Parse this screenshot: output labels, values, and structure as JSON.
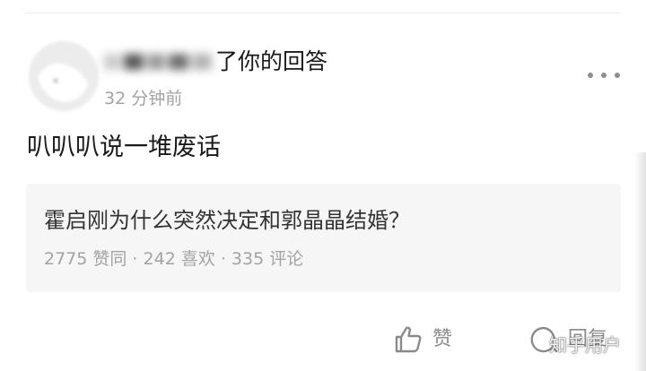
{
  "notification": {
    "actor_name": "",
    "action_text": "了你的回答",
    "time": "32 分钟前",
    "more_icon": "more-dots-icon",
    "avatar_icon": "avatar"
  },
  "comment": {
    "text": "叭叭叭说一堆废话"
  },
  "question": {
    "title": "霍启刚为什么突然决定和郭晶晶结婚？",
    "stats": "2775 赞同 · 242 喜欢 · 335 评论"
  },
  "actions": {
    "like_label": "赞",
    "like_icon": "thumbs-up-icon",
    "reply_label": "回复",
    "reply_icon": "reply-icon"
  },
  "watermark": {
    "text": "知乎用户"
  },
  "colors": {
    "primary_text": "#1a1a1a",
    "secondary_text": "#a3a3a3",
    "card_bg": "#f6f6f6",
    "icon_gray": "#8a8a8a"
  }
}
